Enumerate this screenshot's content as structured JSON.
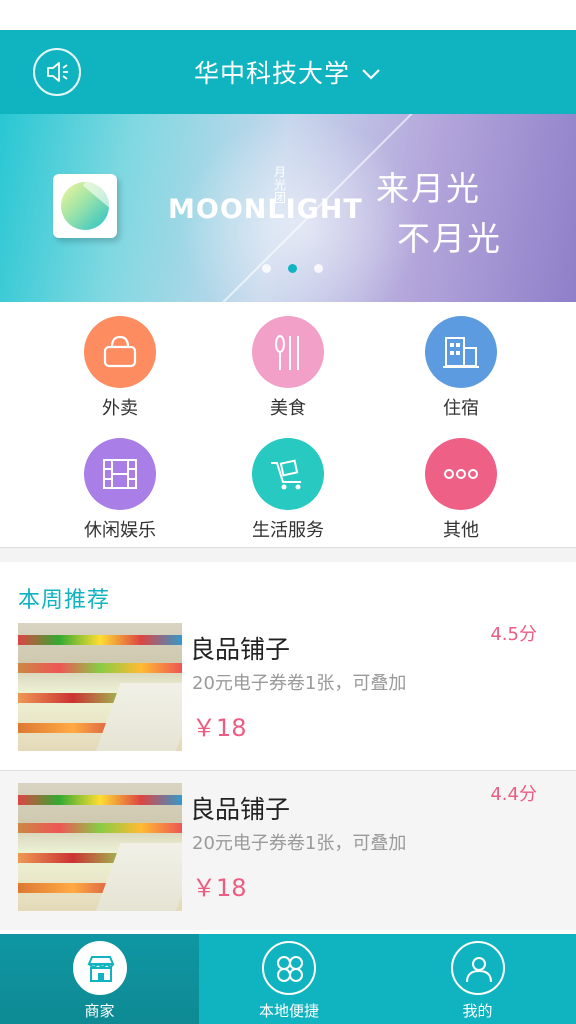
{
  "header": {
    "city": "华中科技大学",
    "speaker_icon": "speaker-icon",
    "chevron_icon": "chevron-down-icon",
    "bg_color": "#10b3c0"
  },
  "banner": {
    "brand": "MOONLIGHT",
    "brand_cn": "月光团",
    "slogan_line1": "来月光",
    "slogan_line2": "不月光",
    "page_count": 3,
    "active_page": 2
  },
  "categories": [
    {
      "label": "外卖",
      "icon": "bag-icon",
      "color": "#fd8c61"
    },
    {
      "label": "美食",
      "icon": "utensils-icon",
      "color": "#f2a0c8"
    },
    {
      "label": "住宿",
      "icon": "building-icon",
      "color": "#5d9be0"
    },
    {
      "label": "休闲娱乐",
      "icon": "film-icon",
      "color": "#a97ee7"
    },
    {
      "label": "生活服务",
      "icon": "cart-icon",
      "color": "#27c9c1"
    },
    {
      "label": "其他",
      "icon": "more-icon",
      "color": "#ee6086"
    }
  ],
  "recommend": {
    "title": "本周推荐",
    "items": [
      {
        "name": "良品铺子",
        "desc": "20元电子券卷1张，可叠加",
        "price": "￥18",
        "score": "4.5分"
      },
      {
        "name": "良品铺子",
        "desc": "20元电子券卷1张，可叠加",
        "price": "￥18",
        "score": "4.4分"
      }
    ]
  },
  "tabs": [
    {
      "label": "商家",
      "icon": "store-icon",
      "active": true
    },
    {
      "label": "本地便捷",
      "icon": "grid-icon",
      "active": false
    },
    {
      "label": "我的",
      "icon": "user-icon",
      "active": false
    }
  ]
}
